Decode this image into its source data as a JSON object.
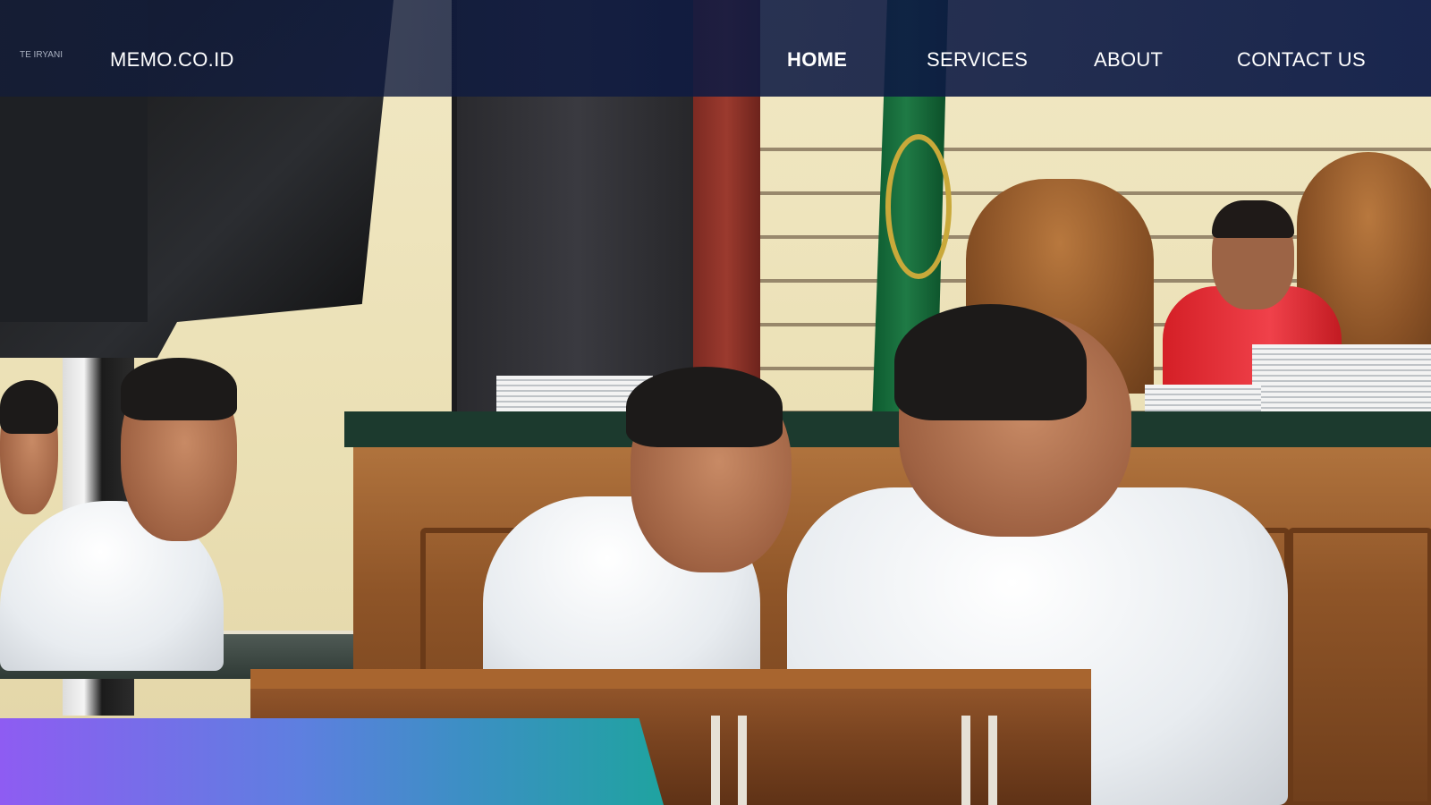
{
  "brand": {
    "logo_text": "MEMO.CO.ID",
    "mark_text": "TE IRYANI"
  },
  "nav": {
    "items": [
      {
        "label": "HOME",
        "active": true
      },
      {
        "label": "SERVICES",
        "active": false
      },
      {
        "label": "ABOUT",
        "active": false
      },
      {
        "label": "CONTACT US",
        "active": false
      }
    ]
  },
  "colors": {
    "nav_bg": "#0e1a42",
    "accent_start": "#8e5cf2",
    "accent_end": "#1fa3a0",
    "text": "#ffffff"
  }
}
